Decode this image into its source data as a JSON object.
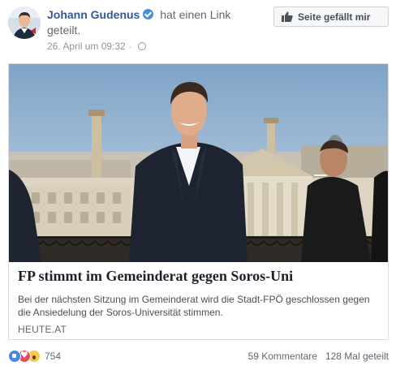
{
  "post": {
    "author": "Johann Gudenus",
    "action_text": "hat einen Link geteilt.",
    "timestamp": "26. April um 09:32",
    "like_page_label": "Seite gefällt mir"
  },
  "link_preview": {
    "title": "FP stimmt im Gemeinderat gegen Soros-Uni",
    "description": "Bei der nächsten Sitzung im Gemeinderat wird die Stadt-FPÖ geschlossen gegen die Ansiedelung der Soros-Universität stimmen.",
    "domain": "HEUTE.AT"
  },
  "footer": {
    "reaction_count": "754",
    "comments": "59 Kommentare",
    "shares": "128 Mal geteilt"
  },
  "icons": {
    "verified": "verified-badge-icon",
    "privacy": "globe-icon",
    "like_page": "thumbs-up-icon",
    "reactions": [
      "like-reaction-icon",
      "love-reaction-icon",
      "wow-reaction-icon"
    ]
  },
  "colors": {
    "author_link": "#365899",
    "verified": "#4a90d9",
    "like_reaction": "#4a86e8",
    "love_reaction": "#f0465d",
    "wow_reaction": "#f7c948"
  }
}
